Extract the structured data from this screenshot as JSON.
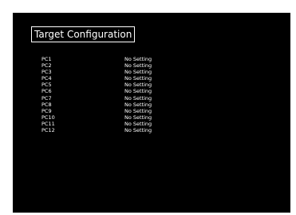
{
  "title": "Target Configuration",
  "targets": [
    {
      "name": "PC1",
      "value": "No Setting"
    },
    {
      "name": "PC2",
      "value": "No Setting"
    },
    {
      "name": "PC3",
      "value": "No Setting"
    },
    {
      "name": "PC4",
      "value": "No Setting"
    },
    {
      "name": "PC5",
      "value": "No Setting"
    },
    {
      "name": "PC6",
      "value": "No Setting"
    },
    {
      "name": "PC7",
      "value": "No Setting"
    },
    {
      "name": "PC8",
      "value": "No Setting"
    },
    {
      "name": "PC9",
      "value": "No Setting"
    },
    {
      "name": "PC10",
      "value": "No Setting"
    },
    {
      "name": "PC11",
      "value": "No Setting"
    },
    {
      "name": "PC12",
      "value": "No Setting"
    }
  ]
}
